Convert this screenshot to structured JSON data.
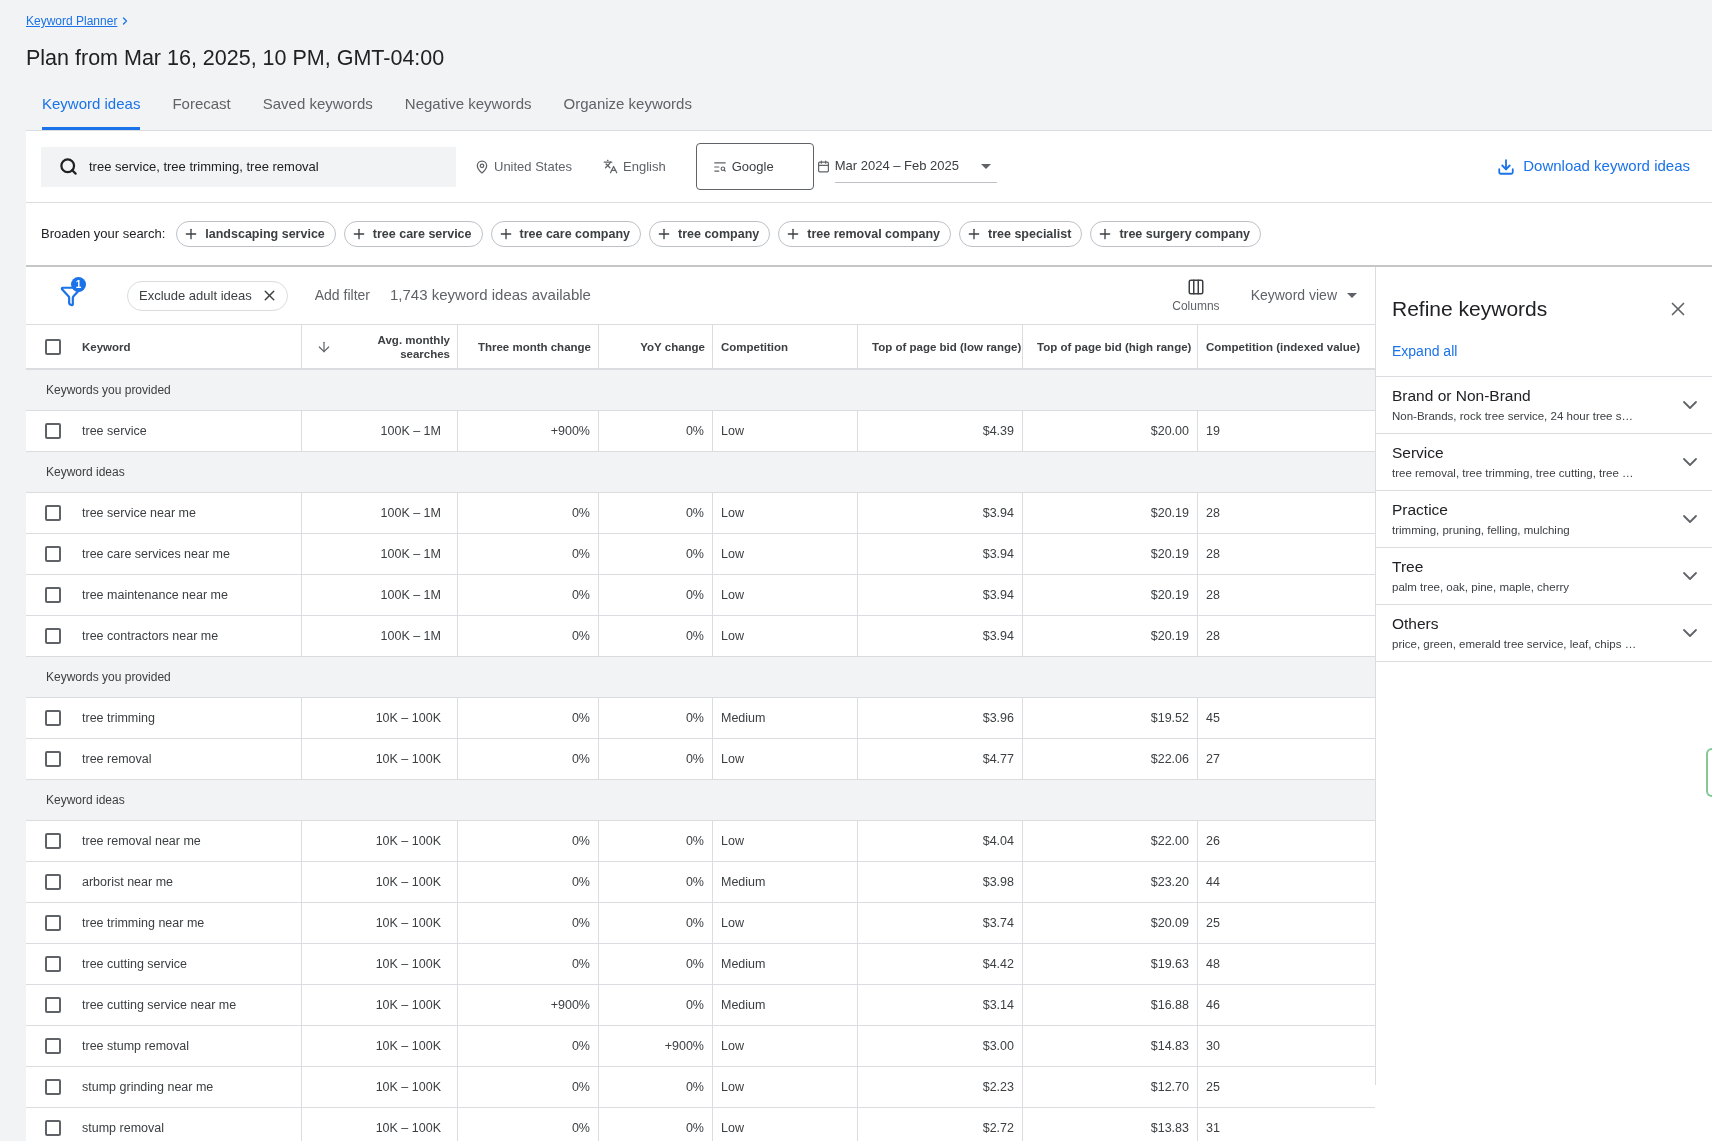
{
  "breadcrumb": {
    "label": "Keyword Planner"
  },
  "title": "Plan from Mar 16, 2025, 10 PM, GMT-04:00",
  "tabs": [
    {
      "label": "Keyword ideas",
      "selected": true
    },
    {
      "label": "Forecast",
      "selected": false
    },
    {
      "label": "Saved keywords",
      "selected": false
    },
    {
      "label": "Negative keywords",
      "selected": false
    },
    {
      "label": "Organize keywords",
      "selected": false
    }
  ],
  "search": {
    "value": "tree service, tree trimming, tree removal"
  },
  "location": "United States",
  "language": "English",
  "network": "Google",
  "date_range": "Mar 2024 – Feb 2025",
  "download": "Download keyword ideas",
  "broaden": {
    "label": "Broaden your search:",
    "chips": [
      "landscaping service",
      "tree care service",
      "tree care company",
      "tree company",
      "tree removal company",
      "tree specialist",
      "tree surgery company"
    ]
  },
  "filters": {
    "badge": "1",
    "chips": [
      "Exclude adult ideas"
    ],
    "add_filter": "Add filter",
    "count": "1,743 keyword ideas available",
    "columns": "Columns",
    "view": "Keyword view"
  },
  "table": {
    "select_all": {
      "checked": false
    },
    "columns": [
      {
        "label": "Keyword",
        "sorted": false
      },
      {
        "label": "Avg. monthly searches",
        "sorted": true
      },
      {
        "label": "Three month change",
        "sorted": false
      },
      {
        "label": "YoY change",
        "sorted": false
      },
      {
        "label": "Competition",
        "sorted": false
      },
      {
        "label": "Top of page bid (low range)",
        "sorted": false
      },
      {
        "label": "Top of page bid (high range)",
        "sorted": false
      },
      {
        "label": "Competition (indexed value)",
        "sorted": false
      }
    ],
    "rows": [
      {
        "kind": "group",
        "label": "Keywords you provided"
      },
      {
        "kind": "keyword",
        "checked": false,
        "cells": [
          "tree service",
          "100K – 1M",
          "+900%",
          "0%",
          "Low",
          "$4.39",
          "$20.00",
          "19"
        ]
      },
      {
        "kind": "group",
        "label": "Keyword ideas"
      },
      {
        "kind": "keyword",
        "checked": false,
        "cells": [
          "tree service near me",
          "100K – 1M",
          "0%",
          "0%",
          "Low",
          "$3.94",
          "$20.19",
          "28"
        ]
      },
      {
        "kind": "keyword",
        "checked": false,
        "cells": [
          "tree care services near me",
          "100K – 1M",
          "0%",
          "0%",
          "Low",
          "$3.94",
          "$20.19",
          "28"
        ]
      },
      {
        "kind": "keyword",
        "checked": false,
        "cells": [
          "tree maintenance near me",
          "100K – 1M",
          "0%",
          "0%",
          "Low",
          "$3.94",
          "$20.19",
          "28"
        ]
      },
      {
        "kind": "keyword",
        "checked": false,
        "cells": [
          "tree contractors near me",
          "100K – 1M",
          "0%",
          "0%",
          "Low",
          "$3.94",
          "$20.19",
          "28"
        ]
      },
      {
        "kind": "group",
        "label": "Keywords you provided"
      },
      {
        "kind": "keyword",
        "checked": false,
        "cells": [
          "tree trimming",
          "10K – 100K",
          "0%",
          "0%",
          "Medium",
          "$3.96",
          "$19.52",
          "45"
        ]
      },
      {
        "kind": "keyword",
        "checked": false,
        "cells": [
          "tree removal",
          "10K – 100K",
          "0%",
          "0%",
          "Low",
          "$4.77",
          "$22.06",
          "27"
        ]
      },
      {
        "kind": "group",
        "label": "Keyword ideas"
      },
      {
        "kind": "keyword",
        "checked": false,
        "cells": [
          "tree removal near me",
          "10K – 100K",
          "0%",
          "0%",
          "Low",
          "$4.04",
          "$22.00",
          "26"
        ]
      },
      {
        "kind": "keyword",
        "checked": false,
        "cells": [
          "arborist near me",
          "10K – 100K",
          "0%",
          "0%",
          "Medium",
          "$3.98",
          "$23.20",
          "44"
        ]
      },
      {
        "kind": "keyword",
        "checked": false,
        "cells": [
          "tree trimming near me",
          "10K – 100K",
          "0%",
          "0%",
          "Low",
          "$3.74",
          "$20.09",
          "25"
        ]
      },
      {
        "kind": "keyword",
        "checked": false,
        "cells": [
          "tree cutting service",
          "10K – 100K",
          "0%",
          "0%",
          "Medium",
          "$4.42",
          "$19.63",
          "48"
        ]
      },
      {
        "kind": "keyword",
        "checked": false,
        "cells": [
          "tree cutting service near me",
          "10K – 100K",
          "+900%",
          "0%",
          "Medium",
          "$3.14",
          "$16.88",
          "46"
        ]
      },
      {
        "kind": "keyword",
        "checked": false,
        "cells": [
          "tree stump removal",
          "10K – 100K",
          "0%",
          "+900%",
          "Low",
          "$3.00",
          "$14.83",
          "30"
        ]
      },
      {
        "kind": "keyword",
        "checked": false,
        "cells": [
          "stump grinding near me",
          "10K – 100K",
          "0%",
          "0%",
          "Low",
          "$2.23",
          "$12.70",
          "25"
        ]
      },
      {
        "kind": "keyword",
        "checked": false,
        "cells": [
          "stump removal",
          "10K – 100K",
          "0%",
          "0%",
          "Low",
          "$2.72",
          "$13.83",
          "31"
        ]
      }
    ]
  },
  "refine": {
    "title": "Refine keywords",
    "expand_all": "Expand all",
    "sections": [
      {
        "title": "Brand or Non-Brand",
        "summary": "Non-Brands, rock tree service, 24 hour tree s…",
        "expanded": false
      },
      {
        "title": "Service",
        "summary": "tree removal, tree trimming, tree cutting, tree …",
        "expanded": false
      },
      {
        "title": "Practice",
        "summary": "trimming, pruning, felling, mulching",
        "expanded": false
      },
      {
        "title": "Tree",
        "summary": "palm tree, oak, pine, maple, cherry",
        "expanded": false
      },
      {
        "title": "Others",
        "summary": "price, green, emerald tree service, leaf, chips …",
        "expanded": false
      }
    ]
  }
}
